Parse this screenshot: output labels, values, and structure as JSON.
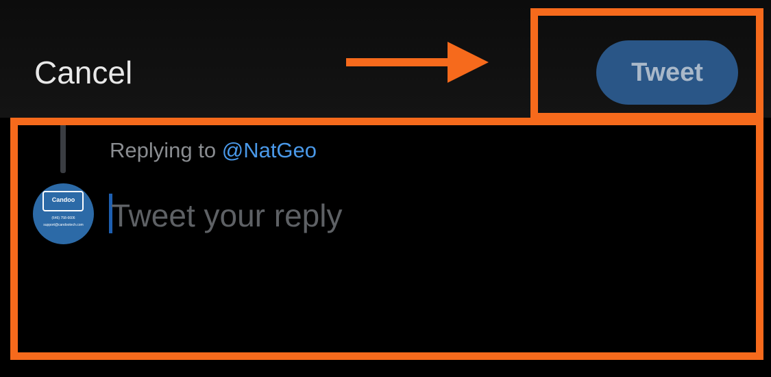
{
  "header": {
    "cancel_label": "Cancel",
    "tweet_label": "Tweet"
  },
  "compose": {
    "replying_prefix": "Replying to",
    "replying_handle": "@NatGeo",
    "placeholder": "Tweet your reply"
  },
  "avatar": {
    "brand": "Candoo",
    "phone": "(646) 758-6606",
    "email": "support@candootech.com"
  },
  "colors": {
    "annotation": "#f66a1c",
    "tweet_button": "#2a5687",
    "handle": "#4a99e9"
  }
}
